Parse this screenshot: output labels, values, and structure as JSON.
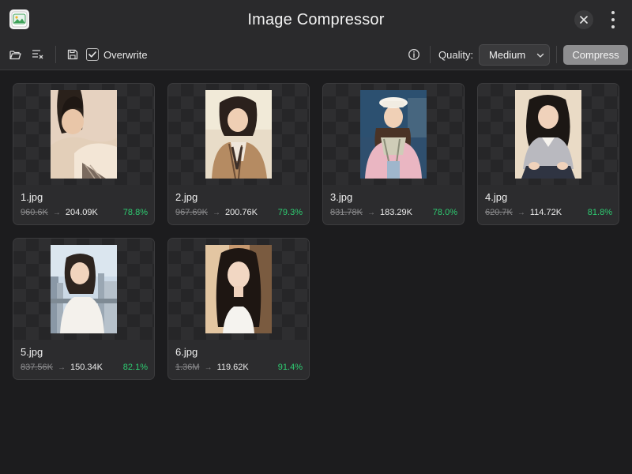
{
  "window": {
    "title": "Image Compressor"
  },
  "icons": {
    "app": "app-icon",
    "close": "close-icon",
    "more": "more-vertical-icon",
    "open_folder": "folder-open-icon",
    "clear_list": "clear-list-icon",
    "save": "save-icon",
    "check": "check-icon",
    "info": "info-icon",
    "chevron": "chevron-down-icon",
    "arrow": "arrow-right-icon"
  },
  "toolbar": {
    "overwrite_label": "Overwrite",
    "overwrite_checked": true,
    "quality_label": "Quality:",
    "quality_value": "Medium",
    "compress_label": "Compress"
  },
  "colors": {
    "background": "#1c1c1e",
    "card": "#2c2c2e",
    "percent": "#2ecc71",
    "compress_button": "#8e8e90"
  },
  "images": [
    {
      "name": "1.jpg",
      "original": "960.6K",
      "compressed": "204.09K",
      "saved": "78.8%"
    },
    {
      "name": "2.jpg",
      "original": "967.69K",
      "compressed": "200.76K",
      "saved": "79.3%"
    },
    {
      "name": "3.jpg",
      "original": "831.78K",
      "compressed": "183.29K",
      "saved": "78.0%"
    },
    {
      "name": "4.jpg",
      "original": "620.7K",
      "compressed": "114.72K",
      "saved": "81.8%"
    },
    {
      "name": "5.jpg",
      "original": "837.56K",
      "compressed": "150.34K",
      "saved": "82.1%"
    },
    {
      "name": "6.jpg",
      "original": "1.36M",
      "compressed": "119.62K",
      "saved": "91.4%"
    }
  ]
}
